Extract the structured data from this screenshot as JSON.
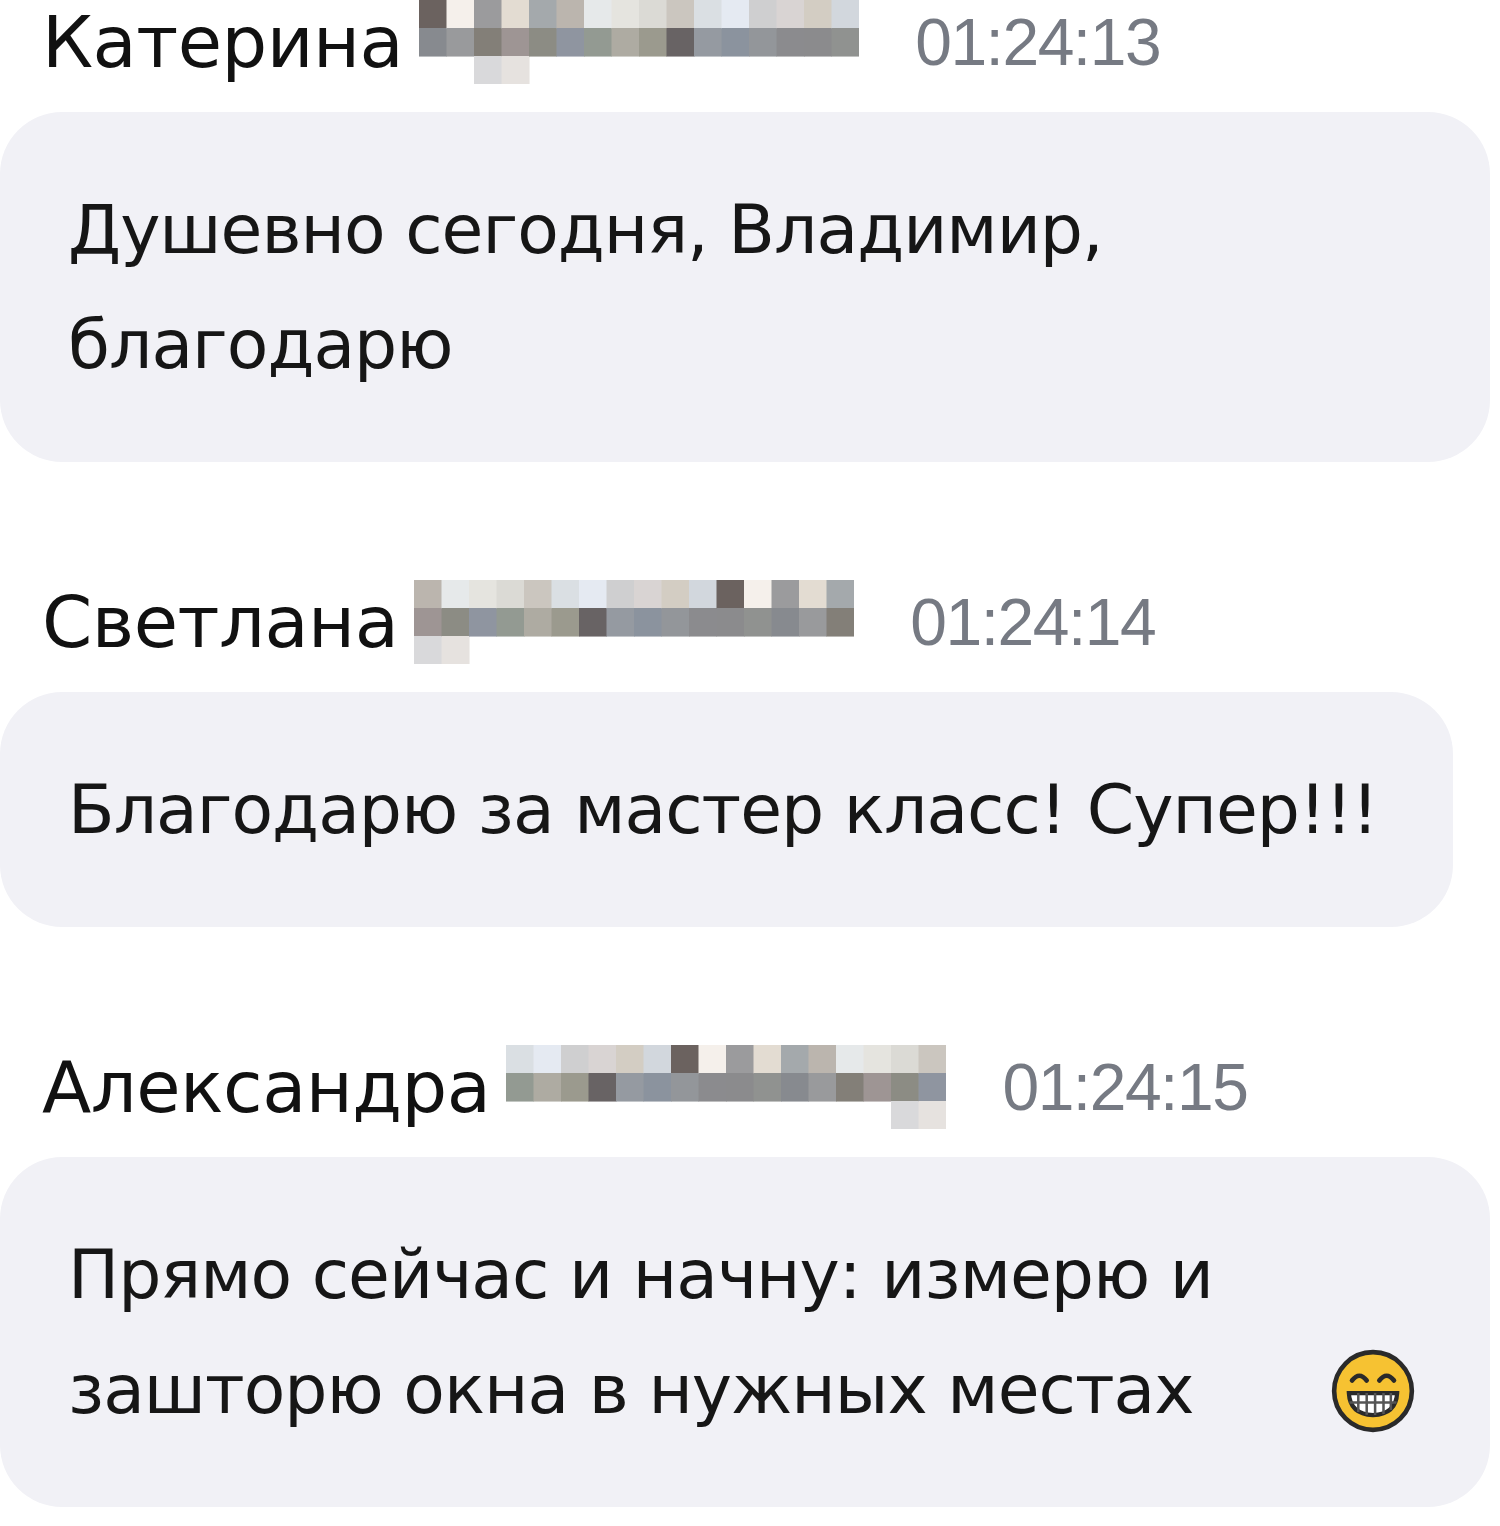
{
  "messages": [
    {
      "author": "Катерина",
      "surname_redacted": true,
      "time": "01:24:13",
      "text": "Душевно сегодня, Владимир, благодарю",
      "emoji": false
    },
    {
      "author": "Светлана",
      "surname_redacted": true,
      "time": "01:24:14",
      "text": "Благодарю за мастер класс! Супер!!!",
      "emoji": false
    },
    {
      "author": "Александра",
      "surname_redacted": true,
      "time": "01:24:15",
      "text": "Прямо сейчас и начну: измерю и зашторю окна в нужных местах",
      "emoji": true
    }
  ]
}
